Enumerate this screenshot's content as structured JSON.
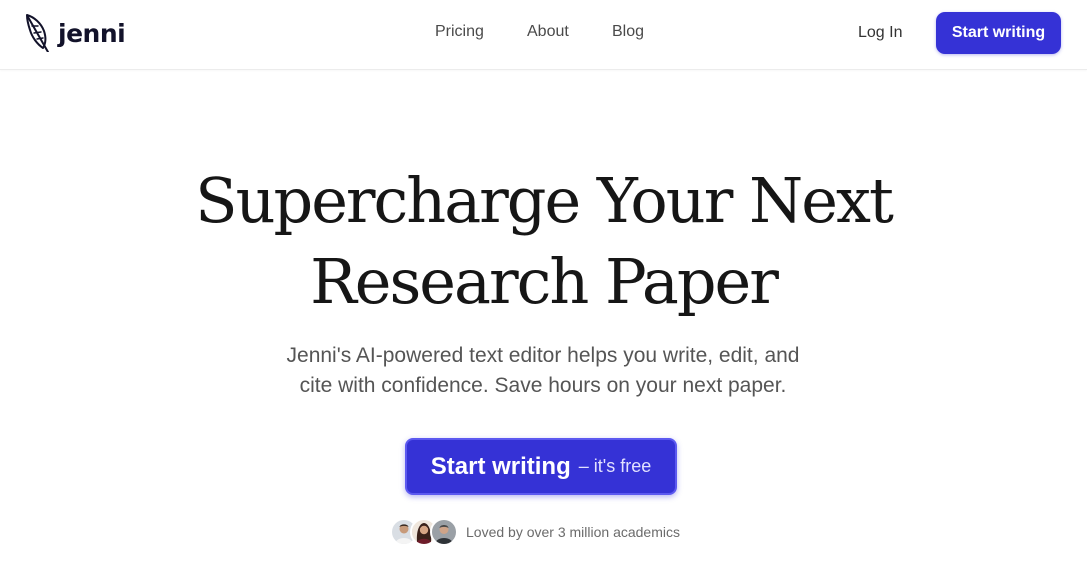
{
  "header": {
    "logo_text": "jenni",
    "logo_icon": "feather-icon",
    "nav": [
      {
        "label": "Pricing"
      },
      {
        "label": "About"
      },
      {
        "label": "Blog"
      }
    ],
    "login_label": "Log In",
    "cta_label": "Start writing"
  },
  "hero": {
    "title_line1": "Supercharge Your Next",
    "title_line2": "Research Paper",
    "subtitle_line1": "Jenni's AI-powered text editor helps you write, edit, and",
    "subtitle_line2": "cite with confidence. Save hours on your next paper.",
    "cta_main": "Start writing",
    "cta_suffix": "– it's free"
  },
  "social_proof": {
    "text": "Loved by over 3 million academics",
    "avatar_count": 3
  },
  "colors": {
    "accent": "#3532d6",
    "text_dark": "#161616",
    "text_muted": "#555555"
  }
}
